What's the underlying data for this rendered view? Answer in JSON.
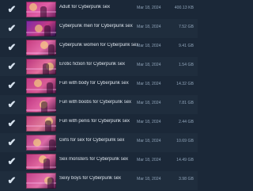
{
  "items": [
    {
      "title": "Adult for Cyberpunk sex",
      "date": "Mar 18, 2024",
      "size": "400.13 KB",
      "checked": true,
      "thumb_colors": [
        "#c83a8a",
        "#e05fa6",
        "#6a1b5a"
      ]
    },
    {
      "title": "Cyberpunk men for Cyberpunk sex",
      "date": "Mar 18, 2024",
      "size": "7.52 GB",
      "checked": true,
      "thumb_colors": [
        "#7a2aa8",
        "#c23a86",
        "#2a1450"
      ]
    },
    {
      "title": "Cyberpunk women for Cyberpunk sex",
      "date": "Mar 18, 2024",
      "size": "9.41 GB",
      "checked": true,
      "thumb_colors": [
        "#c43a7e",
        "#e26aa8",
        "#5a1a4c"
      ]
    },
    {
      "title": "Erotic fiction for Cyberpunk sex",
      "date": "Mar 18, 2024",
      "size": "1.54 GB",
      "checked": true,
      "thumb_colors": [
        "#b8327c",
        "#e4709e",
        "#4e1642"
      ]
    },
    {
      "title": "Fun with body for Cyberpunk sex",
      "date": "Mar 18, 2024",
      "size": "14.32 GB",
      "checked": true,
      "thumb_colors": [
        "#c23886",
        "#d85b96",
        "#581a4e"
      ]
    },
    {
      "title": "Fun with boobs for Cyberpunk sex",
      "date": "Mar 18, 2024",
      "size": "7.81 GB",
      "checked": true,
      "thumb_colors": [
        "#be3480",
        "#e266a4",
        "#501846"
      ]
    },
    {
      "title": "Fun with penis for Cyberpunk sex",
      "date": "Mar 18, 2024",
      "size": "2.44 GB",
      "checked": true,
      "thumb_colors": [
        "#c4407e",
        "#e07a9a",
        "#5c1c48"
      ]
    },
    {
      "title": "Girls for sex for Cyberpunk sex",
      "date": "Mar 18, 2024",
      "size": "10.69 GB",
      "checked": true,
      "thumb_colors": [
        "#b43a82",
        "#dc6aa6",
        "#4a1644"
      ]
    },
    {
      "title": "Sex monsters for Cyberpunk sex",
      "date": "Mar 18, 2024",
      "size": "14.49 GB",
      "checked": true,
      "thumb_colors": [
        "#b8367e",
        "#e46aa0",
        "#521848"
      ]
    },
    {
      "title": "Sexy boys for Cyberpunk sex",
      "date": "Mar 18, 2024",
      "size": "3.98 GB",
      "checked": true,
      "thumb_colors": [
        "#c03c86",
        "#e070aa",
        "#56184c"
      ]
    }
  ]
}
